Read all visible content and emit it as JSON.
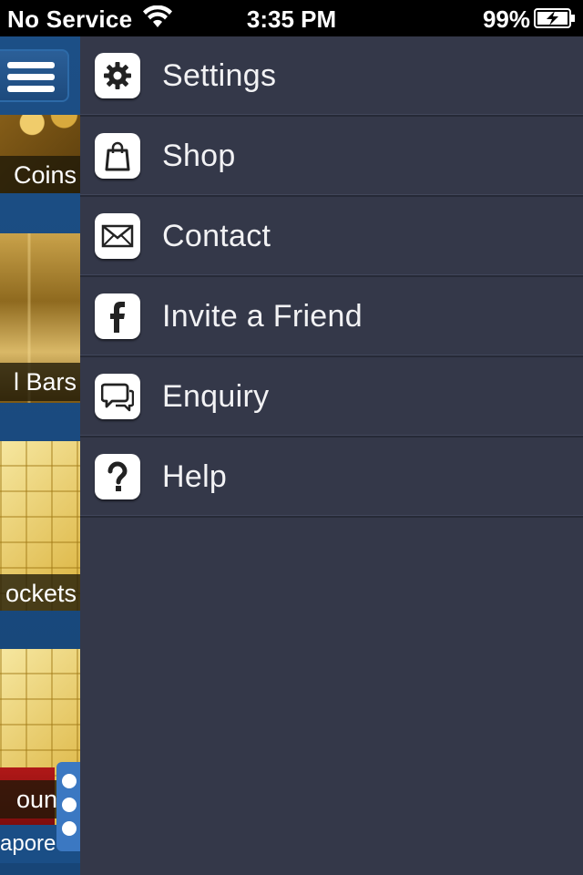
{
  "status_bar": {
    "carrier": "No Service",
    "time": "3:35 PM",
    "battery_percent": "99%",
    "icons": [
      "wifi-icon",
      "battery-charging-icon"
    ]
  },
  "background_app": {
    "tiles": [
      {
        "caption": "Coins"
      },
      {
        "caption": "l Bars"
      },
      {
        "caption": "ockets"
      },
      {
        "caption": "ounts",
        "subcaption": "apore"
      }
    ],
    "page_indicator_count": 3
  },
  "drawer": {
    "items": [
      {
        "label": "Settings",
        "icon": "gear-icon"
      },
      {
        "label": "Shop",
        "icon": "shopping-bag-icon"
      },
      {
        "label": "Contact",
        "icon": "envelope-icon"
      },
      {
        "label": "Invite a Friend",
        "icon": "facebook-icon"
      },
      {
        "label": "Enquiry",
        "icon": "chat-bubbles-icon"
      },
      {
        "label": "Help",
        "icon": "question-mark-icon"
      }
    ]
  },
  "colors": {
    "drawer_bg": "#343849",
    "drawer_divider": "#262a37",
    "label_text": "#f2f2f4",
    "background_app_blue": "#1c4f86",
    "status_bar_bg": "#000000"
  }
}
